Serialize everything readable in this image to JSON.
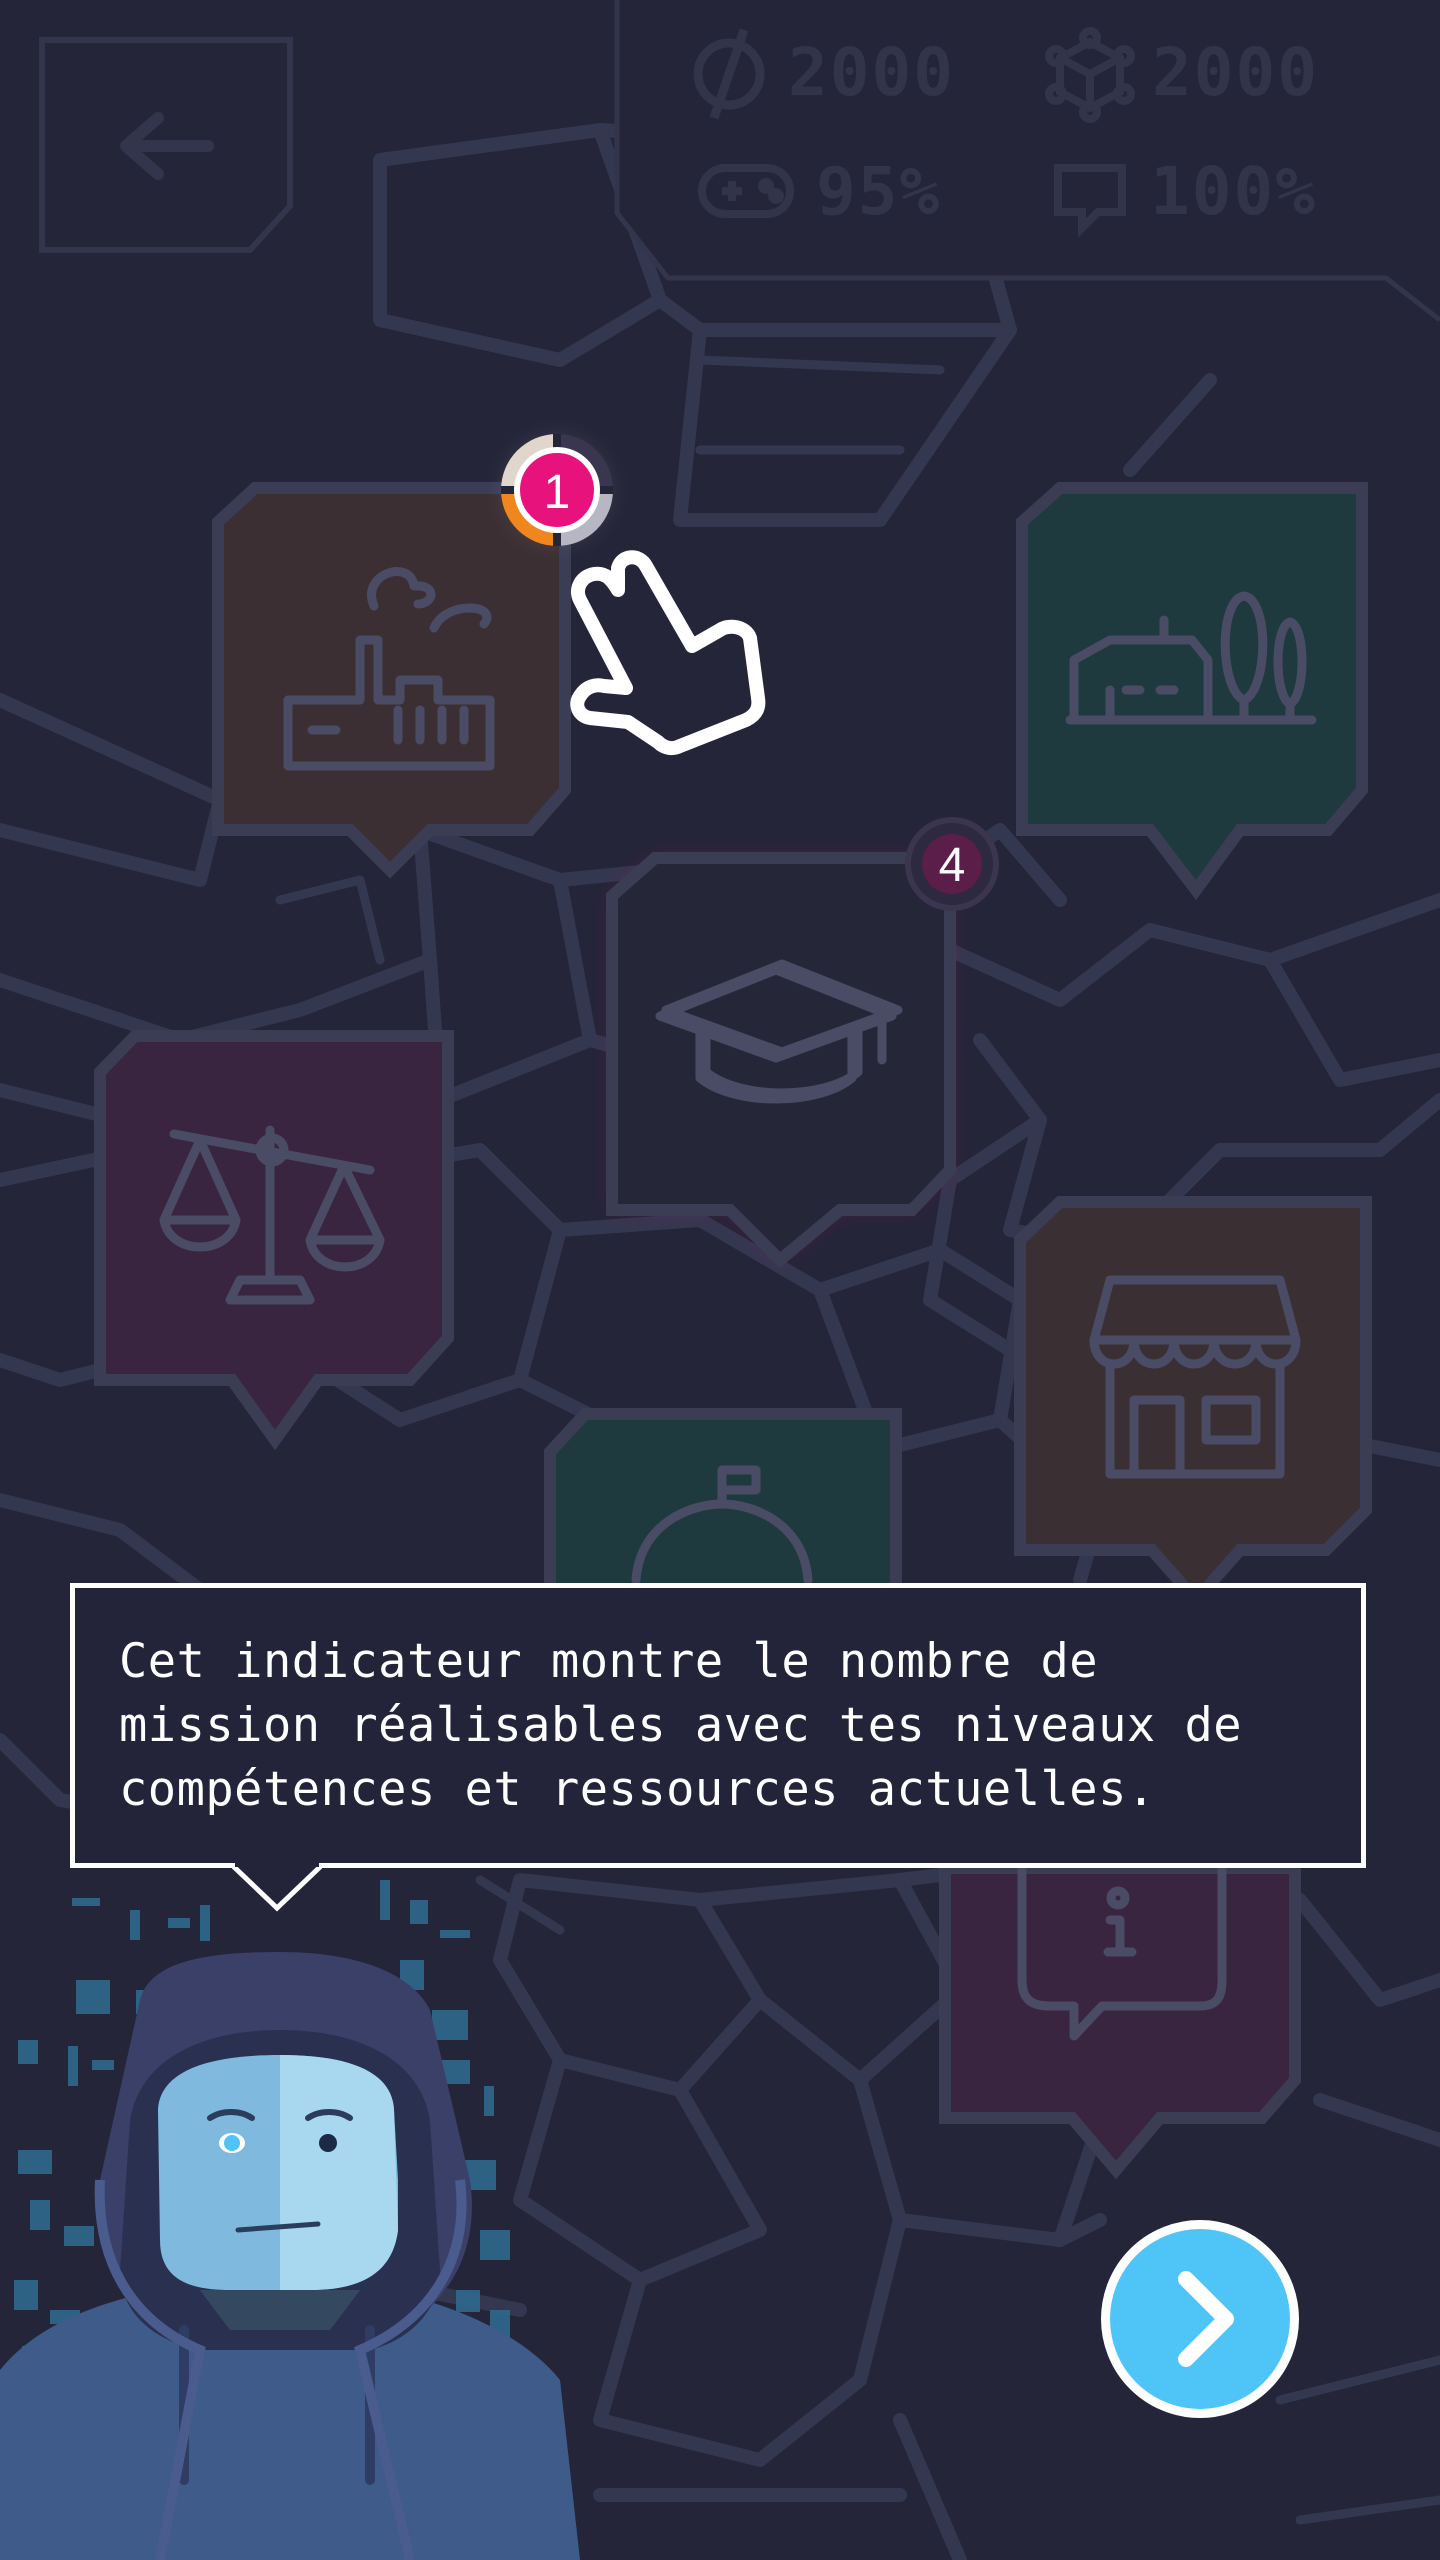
{
  "hud": {
    "coins": "2000",
    "data": "2000",
    "game_stat": "95%",
    "chat_stat": "100%",
    "icons": [
      "coin-icon",
      "cube-network-icon",
      "gamepad-icon",
      "speech-bubble-icon"
    ]
  },
  "back_button": {
    "icon": "arrow-left-icon"
  },
  "map_pins": [
    {
      "name": "factory",
      "icon": "factory-icon",
      "color": "#3c2f33"
    },
    {
      "name": "house",
      "icon": "house-trees-icon",
      "color": "#1f3a3e"
    },
    {
      "name": "school",
      "icon": "graduation-cap-icon",
      "color": "#262838"
    },
    {
      "name": "justice",
      "icon": "scales-icon",
      "color": "#3a2540"
    },
    {
      "name": "shop",
      "icon": "shop-icon",
      "color": "#3a2f33"
    },
    {
      "name": "hotel",
      "icon": "service-bell-icon",
      "color": "#1f3a3e"
    },
    {
      "name": "info",
      "icon": "info-icon",
      "color": "#3a2540"
    }
  ],
  "badges": {
    "highlighted": "1",
    "school": "4"
  },
  "tutorial": {
    "lines": [
      "Cet indicateur montre le nombre de",
      "mission réalisables avec tes niveaux de",
      "compétences et ressources actuelles."
    ]
  },
  "next_button": {
    "icon": "chevron-right-icon"
  },
  "colors": {
    "background": "#242538",
    "accent_pink": "#e8127c",
    "accent_blue": "#4ec4f7",
    "accent_orange": "#f0861e"
  }
}
